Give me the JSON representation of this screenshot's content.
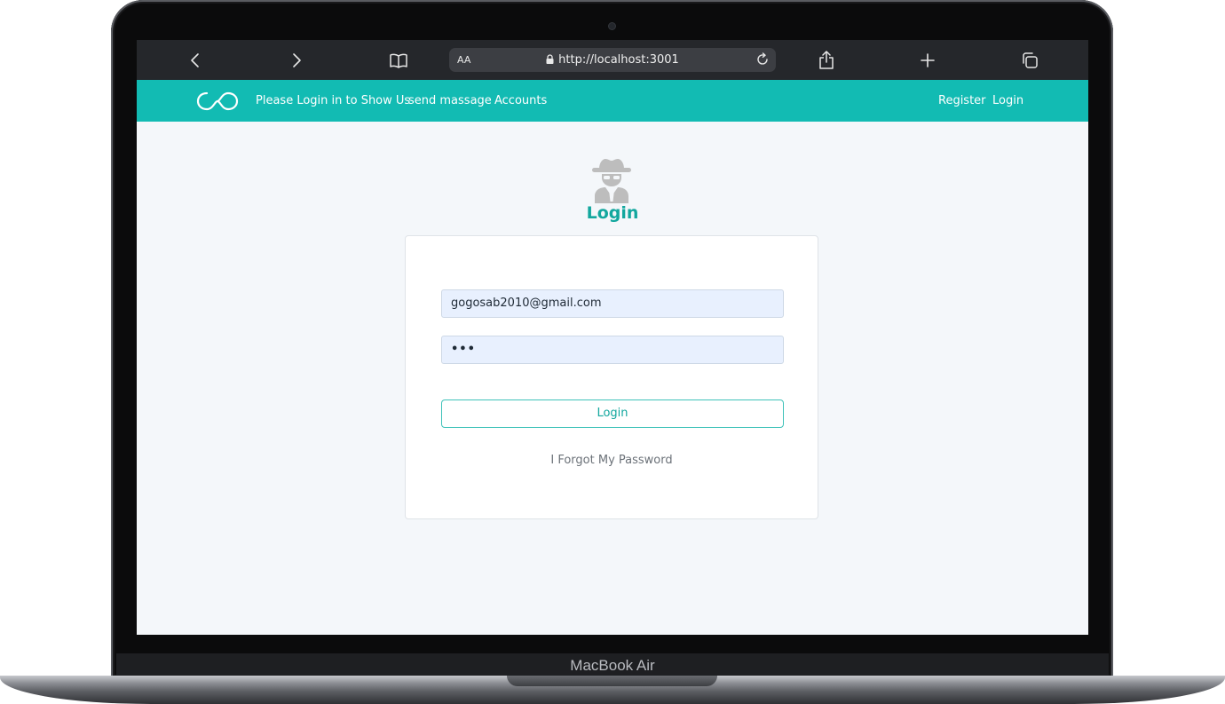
{
  "device": {
    "label": "MacBook Air"
  },
  "browser": {
    "text_size_label": "AA",
    "url": "http://localhost:3001",
    "icons": [
      "back-icon",
      "forward-icon",
      "bookmarks-icon",
      "lock-icon",
      "reload-icon",
      "share-icon",
      "new-tab-icon",
      "tabs-icon"
    ]
  },
  "navbar": {
    "logo": "infinity-logo",
    "links": [
      "Please Login in to Show Us",
      "send massage",
      "Accounts"
    ],
    "right_links": [
      "Register",
      "Login"
    ],
    "background": "#12bbb3"
  },
  "login": {
    "icon": "spy-icon",
    "title": "Login",
    "email_value": "gogosab2010@gmail.com",
    "password_value": "•••",
    "button_label": "Login",
    "forgot_label": "I Forgot My Password",
    "accent": "#12a79e"
  }
}
